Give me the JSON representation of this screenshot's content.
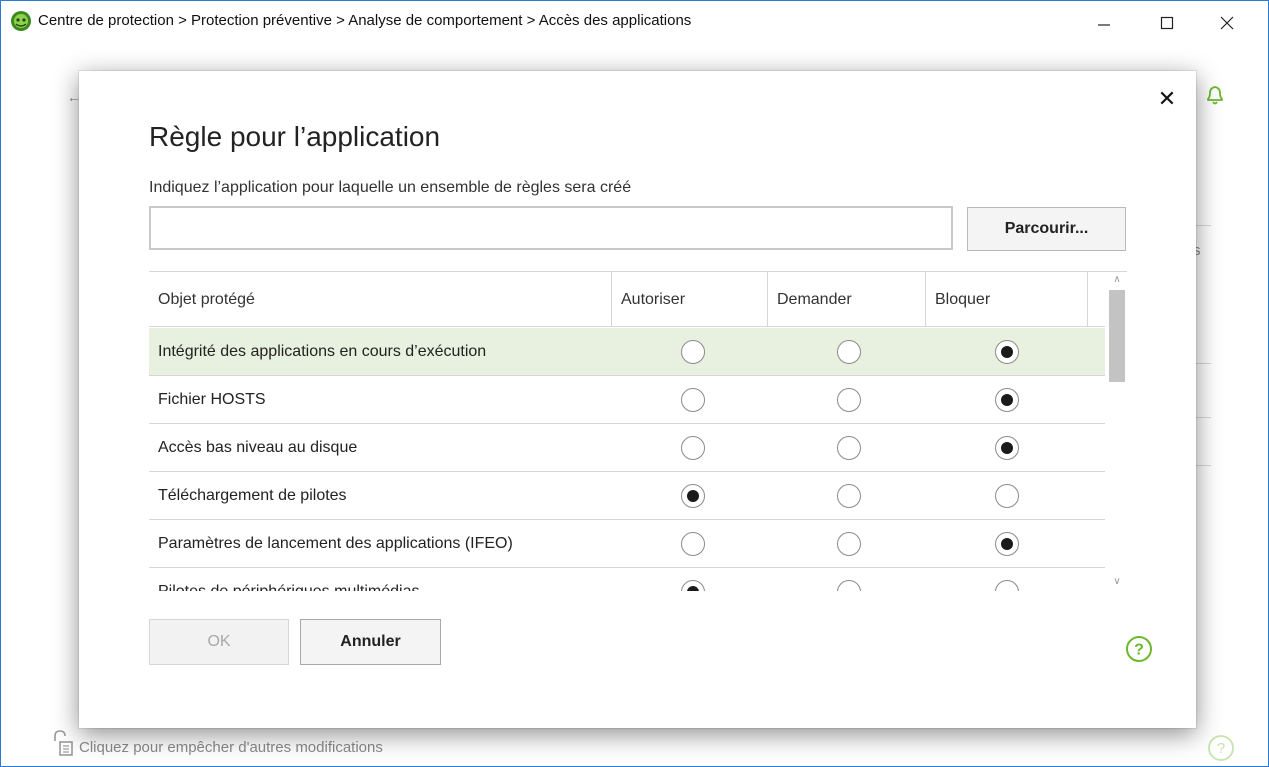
{
  "window": {
    "title": "Centre de protection > Protection préventive > Analyse de comportement > Accès des applications",
    "minimize_icon": "minimize-icon",
    "maximize_icon": "maximize-icon",
    "close_icon": "close-icon",
    "logo_icon": "dr-web-spider-logo"
  },
  "background": {
    "lock_label": "Cliquez pour empêcher d'autres modifications",
    "partial_letter": "s"
  },
  "dialog": {
    "title": "Règle pour l’application",
    "subtitle": "Indiquez l’application pour laquelle un ensemble de règles sera créé",
    "app_input_value": "",
    "browse_label": "Parcourir...",
    "ok_label": "OK",
    "cancel_label": "Annuler",
    "table": {
      "headers": [
        "Objet protégé",
        "Autoriser",
        "Demander",
        "Bloquer"
      ],
      "rows": [
        {
          "name": "Intégrité des applications en cours d’exécution",
          "choice": "Bloquer",
          "selected": true
        },
        {
          "name": "Fichier HOSTS",
          "choice": "Bloquer"
        },
        {
          "name": "Accès bas niveau au disque",
          "choice": "Bloquer"
        },
        {
          "name": "Téléchargement de pilotes",
          "choice": "Autoriser"
        },
        {
          "name": "Paramètres de lancement des applications (IFEO)",
          "choice": "Bloquer"
        },
        {
          "name": "Pilotes de périphériques multimédias",
          "choice": "Autoriser"
        }
      ]
    }
  },
  "colors": {
    "accent_green": "#6bb82c",
    "selected_row": "#e8f1df",
    "window_border": "#2b7bd6"
  }
}
